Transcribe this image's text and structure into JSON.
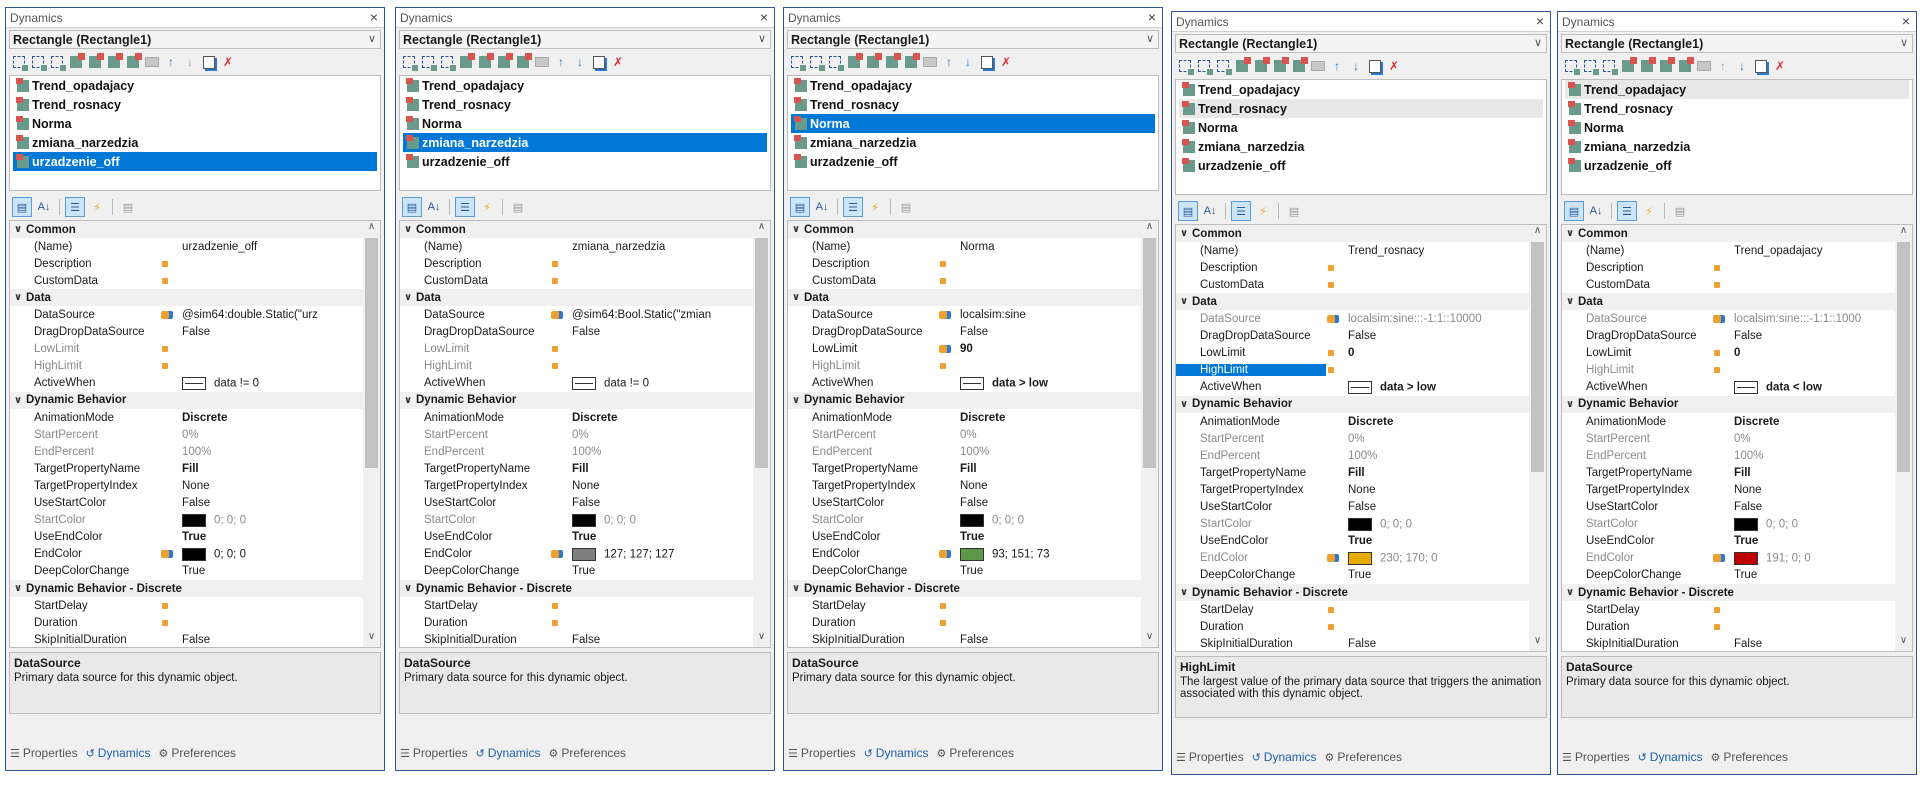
{
  "panels": [
    {
      "title": "Dynamics",
      "object": "Rectangle (Rectangle1)",
      "items": [
        "Trend_opadajacy",
        "Trend_rosnacy",
        "Norma",
        "zmiana_narzedzia",
        "urzadzenie_off"
      ],
      "selected": 4,
      "name": "urzadzenie_off",
      "datasource": "@sim64:double.Static(\"urz",
      "low": "",
      "high": "",
      "lowDim": true,
      "highDim": true,
      "activeWhen": "data != 0",
      "activeBold": false,
      "endColor": "0; 0; 0",
      "endColorHex": "#000000",
      "help_title": "DataSource",
      "help_text": "Primary data source for this dynamic object."
    },
    {
      "title": "Dynamics",
      "object": "Rectangle (Rectangle1)",
      "items": [
        "Trend_opadajacy",
        "Trend_rosnacy",
        "Norma",
        "zmiana_narzedzia",
        "urzadzenie_off"
      ],
      "selected": 3,
      "name": "zmiana_narzedzia",
      "datasource": "@sim64:Bool.Static(\"zmian",
      "low": "",
      "high": "",
      "lowDim": true,
      "highDim": true,
      "activeWhen": "data != 0",
      "activeBold": false,
      "endColor": "127; 127; 127",
      "endColorHex": "#7f7f7f",
      "help_title": "DataSource",
      "help_text": "Primary data source for this dynamic object."
    },
    {
      "title": "Dynamics",
      "object": "Rectangle (Rectangle1)",
      "items": [
        "Trend_opadajacy",
        "Trend_rosnacy",
        "Norma",
        "zmiana_narzedzia",
        "urzadzenie_off"
      ],
      "selected": 2,
      "name": "Norma",
      "datasource": "localsim:sine",
      "low": "90",
      "high": "",
      "lowDim": false,
      "highDim": true,
      "activeWhen": "data > low",
      "activeBold": true,
      "endColor": "93; 151; 73",
      "endColorHex": "#5d9749",
      "help_title": "DataSource",
      "help_text": "Primary data source for this dynamic object."
    },
    {
      "title": "Dynamics",
      "object": "Rectangle (Rectangle1)",
      "items": [
        "Trend_opadajacy",
        "Trend_rosnacy",
        "Norma",
        "zmiana_narzedzia",
        "urzadzenie_off"
      ],
      "selected": -1,
      "name": "Trend_rosnacy",
      "datasource": "localsim:sine:::-1:1::10000",
      "low": "0",
      "high": "",
      "lowDim": false,
      "highDim": false,
      "activeWhen": "data > low",
      "activeBold": true,
      "endColor": "230; 170; 0",
      "endColorHex": "#e6aa00",
      "help_title": "HighLimit",
      "help_text": "The largest value of the primary data source that triggers the animation associated with this dynamic object."
    },
    {
      "title": "Dynamics",
      "object": "Rectangle (Rectangle1)",
      "items": [
        "Trend_opadajacy",
        "Trend_rosnacy",
        "Norma",
        "zmiana_narzedzia",
        "urzadzenie_off"
      ],
      "selected": -1,
      "name": "Trend_opadajacy",
      "datasource": "localsim:sine:::-1:1::1000",
      "low": "0",
      "high": "",
      "lowDim": false,
      "highDim": true,
      "activeWhen": "data < low",
      "activeBold": true,
      "endColor": "191; 0; 0",
      "endColorHex": "#bf0000",
      "help_title": "DataSource",
      "help_text": "Primary data source for this dynamic object."
    }
  ],
  "labels": {
    "common": "Common",
    "name": "(Name)",
    "description": "Description",
    "customData": "CustomData",
    "data": "Data",
    "dataSource": "DataSource",
    "dragDrop": "DragDropDataSource",
    "dragDropVal": "False",
    "lowLimit": "LowLimit",
    "highLimit": "HighLimit",
    "activeWhen": "ActiveWhen",
    "dynBehavior": "Dynamic Behavior",
    "animMode": "AnimationMode",
    "animModeVal": "Discrete",
    "startPercent": "StartPercent",
    "startPercentVal": "0%",
    "endPercent": "EndPercent",
    "endPercentVal": "100%",
    "targetProp": "TargetPropertyName",
    "targetPropVal": "Fill",
    "targetIdx": "TargetPropertyIndex",
    "targetIdxVal": "None",
    "useStart": "UseStartColor",
    "useStartVal": "False",
    "startColor": "StartColor",
    "startColorVal": "0; 0; 0",
    "useEnd": "UseEndColor",
    "useEndVal": "True",
    "endColor": "EndColor",
    "deepColor": "DeepColorChange",
    "deepColorVal": "True",
    "dynDiscrete": "Dynamic Behavior - Discrete",
    "startDelay": "StartDelay",
    "duration": "Duration",
    "skipInit": "SkipInitialDuration",
    "skipInitVal": "False"
  },
  "tabs": [
    "Properties",
    "Dynamics",
    "Preferences"
  ]
}
